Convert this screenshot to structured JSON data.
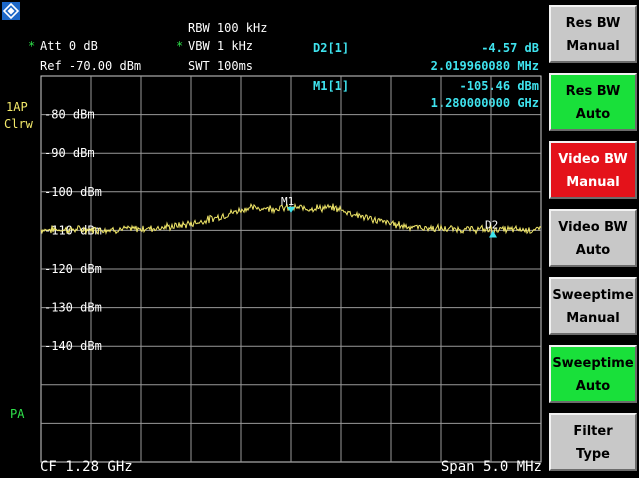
{
  "header": {
    "rbw": "RBW 100 kHz",
    "att_star": "*",
    "att": "Att  0 dB",
    "vbw_star": "*",
    "vbw": "VBW 1 kHz",
    "ref": "Ref  -70.00 dBm",
    "swt": "SWT 100ms"
  },
  "markers": {
    "d2_label": "D2[1]",
    "d2_value1": "-4.57 dB",
    "d2_value2": "2.019960080 MHz",
    "m1_label": "M1[1]",
    "m1_value1": "-105.46 dBm",
    "m1_value2": "1.280000000 GHz",
    "m1_tag": "M1",
    "d2_tag": "D2"
  },
  "left_labels": {
    "trace_mode": "1AP",
    "detector": "Clrw",
    "preamp": "PA"
  },
  "y_ticks": [
    "-80 dBm",
    "-90 dBm",
    "-100 dBm",
    "-110 dBm",
    "-120 dBm",
    "-130 dBm",
    "-140 dBm"
  ],
  "footer": {
    "center_freq": "CF 1.28 GHz",
    "span": "Span 5.0 MHz"
  },
  "softkeys": [
    {
      "line1": "Res BW",
      "line2": "Manual",
      "state": "gray"
    },
    {
      "line1": "Res BW",
      "line2": "Auto",
      "state": "green"
    },
    {
      "line1": "Video BW",
      "line2": "Manual",
      "state": "red"
    },
    {
      "line1": "Video BW",
      "line2": "Auto",
      "state": "gray"
    },
    {
      "line1": "Sweeptime",
      "line2": "Manual",
      "state": "gray"
    },
    {
      "line1": "Sweeptime",
      "line2": "Auto",
      "state": "green"
    },
    {
      "line1": "Filter",
      "line2": "Type",
      "state": "gray"
    }
  ],
  "colors": {
    "trace": "#f3e96a",
    "marker": "#3fe3ee",
    "grid": "#9a9a9a",
    "active": "#19e03a",
    "alert": "#e4121a"
  },
  "trace": {
    "ref_level_dbm": -70,
    "db_per_div": 10,
    "noise_floor_dbm": -109.8,
    "hump_peak_dbm": -104.2,
    "hump_center_frac": 0.5,
    "hump_width_frac": 0.16
  }
}
